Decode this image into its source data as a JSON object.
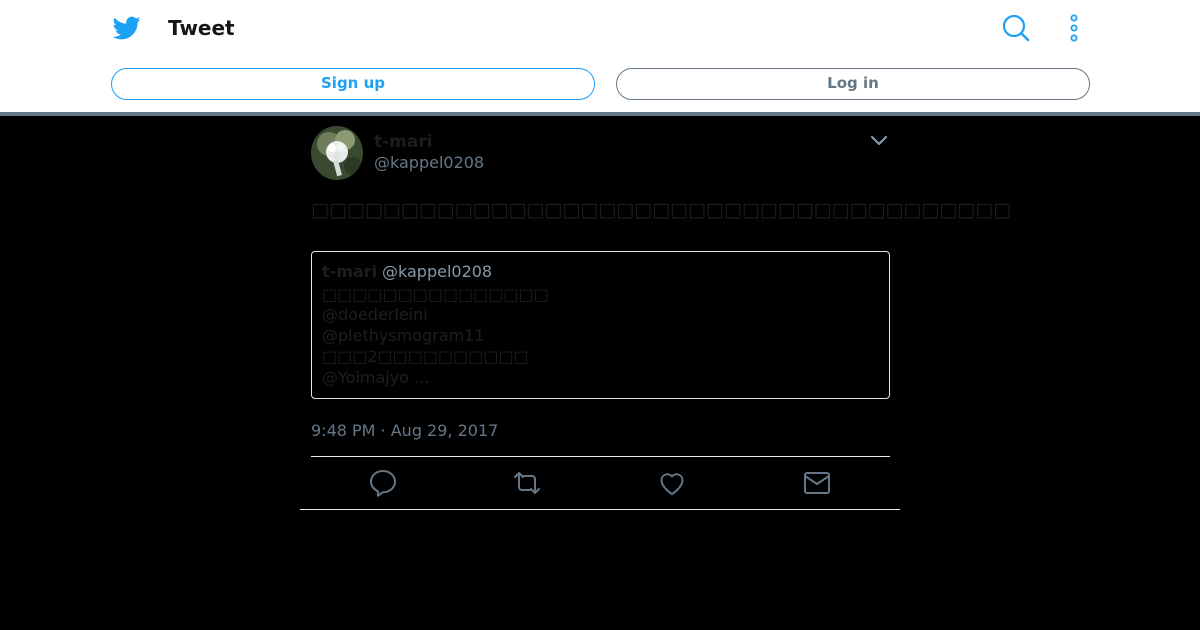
{
  "header": {
    "title": "Tweet",
    "icons": {
      "logo": "twitter-bird-icon",
      "search": "search-icon",
      "more": "more-vertical-icon"
    }
  },
  "auth": {
    "signup_label": "Sign up",
    "login_label": "Log in"
  },
  "tweet": {
    "display_name": "t-mari",
    "handle": "@kappel0208",
    "text": "□□□□□□□□□□□□□□□□□□□□□□□□□□□□□□□□□□□□□□□",
    "timestamp": "9:48 PM · Aug 29, 2017",
    "quote": {
      "display_name": "t-mari",
      "handle": "@kappel0208",
      "lines": [
        "□□□□□□□□□□□□□□□",
        "@doederleini",
        "@plethysmogram11",
        "□□□2□□□□□□□□□□",
        "@Yoimajyo ..."
      ]
    }
  },
  "actions": {
    "icons": [
      "reply-icon",
      "retweet-icon",
      "like-icon",
      "direct-message-icon"
    ]
  },
  "colors": {
    "brand": "#1da1f2",
    "muted": "#657786",
    "background": "#000000",
    "header_bg": "#ffffff"
  }
}
